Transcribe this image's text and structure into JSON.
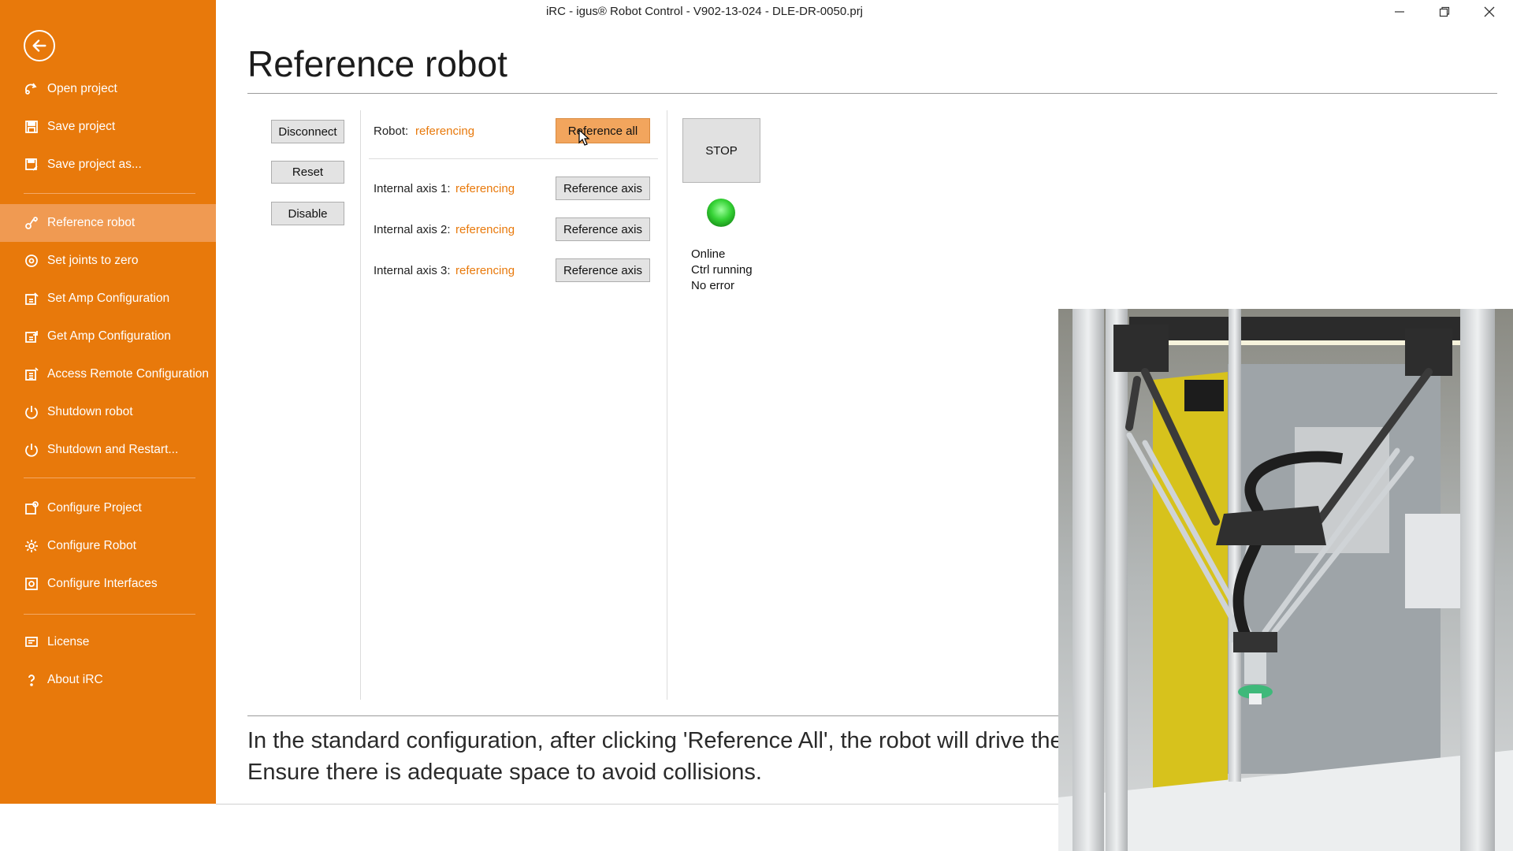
{
  "window": {
    "title": "iRC - igus® Robot Control - V902-13-024 - DLE-DR-0050.prj"
  },
  "sidebar": {
    "items": [
      {
        "label": "Open project",
        "icon": "open-project-icon"
      },
      {
        "label": "Save project",
        "icon": "save-icon"
      },
      {
        "label": "Save project as...",
        "icon": "save-as-icon"
      },
      {
        "label": "Reference robot",
        "icon": "reference-robot-icon"
      },
      {
        "label": "Set joints to zero",
        "icon": "set-joints-zero-icon"
      },
      {
        "label": "Set Amp Configuration",
        "icon": "set-amp-config-icon"
      },
      {
        "label": "Get Amp Configuration",
        "icon": "get-amp-config-icon"
      },
      {
        "label": "Access Remote Configuration",
        "icon": "remote-config-icon"
      },
      {
        "label": "Shutdown robot",
        "icon": "power-icon"
      },
      {
        "label": "Shutdown and Restart...",
        "icon": "power-restart-icon"
      },
      {
        "label": "Configure Project",
        "icon": "configure-project-icon"
      },
      {
        "label": "Configure Robot",
        "icon": "gear-icon"
      },
      {
        "label": "Configure Interfaces",
        "icon": "interfaces-icon"
      },
      {
        "label": "License",
        "icon": "license-icon"
      },
      {
        "label": "About iRC",
        "icon": "help-icon"
      }
    ],
    "active": "Reference robot"
  },
  "main": {
    "title": "Reference robot",
    "buttons": {
      "disconnect": "Disconnect",
      "reset": "Reset",
      "disable": "Disable",
      "reference_all": "Reference all",
      "reference_axis": "Reference axis",
      "stop": "STOP"
    },
    "robot": {
      "label": "Robot:",
      "status": "referencing"
    },
    "axes": [
      {
        "label": "Internal axis 1:",
        "status": "referencing"
      },
      {
        "label": "Internal axis 2:",
        "status": "referencing"
      },
      {
        "label": "Internal axis 3:",
        "status": "referencing"
      }
    ],
    "state": {
      "connection": "Online",
      "control": "Ctrl running",
      "error": "No error"
    },
    "hint": {
      "line1": "In the standard configuration, after clicking 'Reference All', the robot will drive the j",
      "line2": "Ensure there is adequate space to avoid collisions."
    }
  },
  "colors": {
    "accent": "#e8790b",
    "active_item": "#f09a52",
    "status_text": "#e8790b",
    "led": "#35d235"
  }
}
